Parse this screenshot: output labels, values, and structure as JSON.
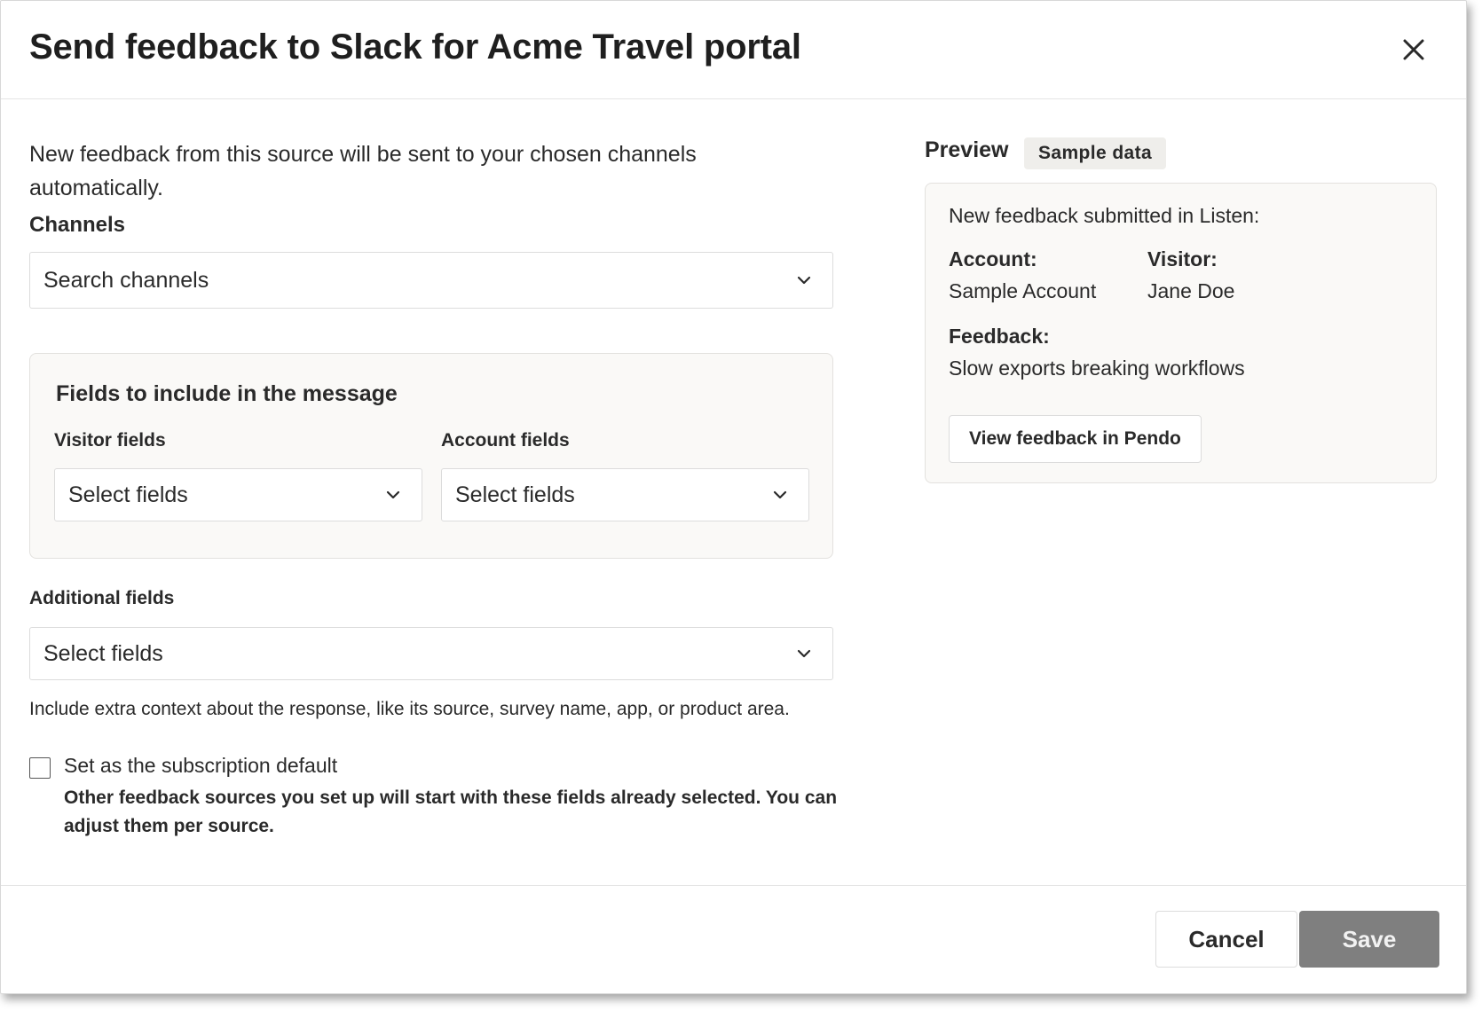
{
  "dialog": {
    "title": "Send feedback to Slack for Acme Travel portal",
    "close_icon": "close-icon"
  },
  "form": {
    "intro": "New feedback from this source will be sent to your chosen channels automatically.",
    "channels_label": "Channels",
    "channels_select": {
      "value": "Search channels",
      "icon": "chevron-down-icon"
    },
    "fields_box": {
      "title": "Fields to include in the message",
      "visitor_label": "Visitor fields",
      "visitor_select": "Select fields",
      "account_label": "Account fields",
      "account_select": "Select fields"
    },
    "additional_label": "Additional fields",
    "additional_select": "Select fields",
    "additional_help": "Include extra context about the response, like its source, survey name, app, or product area.",
    "default_checkbox": {
      "checked": false,
      "label": "Set as the subscription default",
      "description": "Other feedback sources you set up will start with these fields already selected. You can adjust them per source."
    }
  },
  "preview": {
    "title": "Preview",
    "badge": "Sample data",
    "heading": "New feedback submitted in Listen:",
    "account_label": "Account:",
    "account_value": "Sample Account",
    "visitor_label": "Visitor:",
    "visitor_value": "Jane Doe",
    "feedback_label": "Feedback:",
    "feedback_value": "Slow exports breaking workflows",
    "view_button": "View feedback in Pendo"
  },
  "footer": {
    "cancel": "Cancel",
    "save": "Save"
  }
}
